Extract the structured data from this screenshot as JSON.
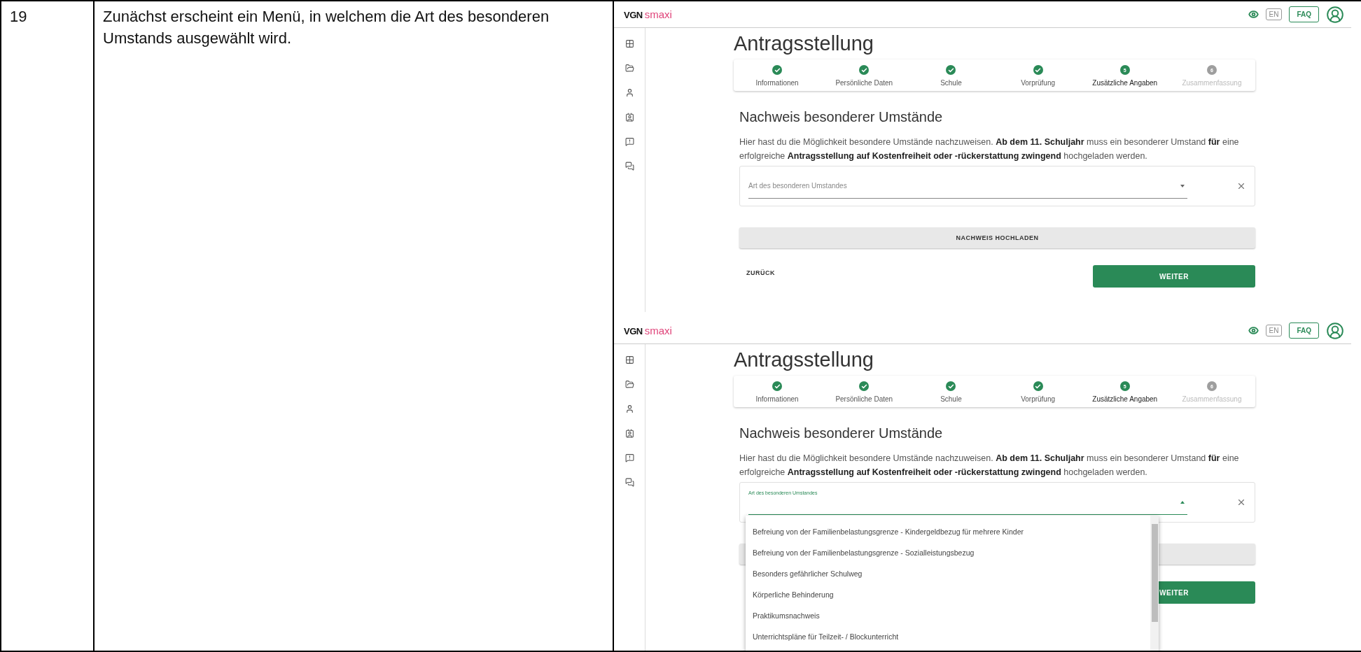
{
  "table": {
    "number": "19",
    "description": "Zunächst erscheint ein Menü, in welchem die Art des besonderen Umstands ausgewählt wird.",
    "screenshots": [
      {
        "logo_brand": "VGN",
        "logo_product": "smaxi",
        "language": "EN",
        "faq": "FAQ",
        "title": "Antragsstellung",
        "steps": [
          {
            "label": "Informationen",
            "completed": true,
            "selected": false
          },
          {
            "label": "Persönliche Daten",
            "completed": true,
            "selected": false
          },
          {
            "label": "Schule",
            "completed": true,
            "selected": false
          },
          {
            "label": "Vorprüfung",
            "completed": true,
            "selected": false
          },
          {
            "label": "Zusätzliche Angaben",
            "completed": false,
            "selected": true,
            "number": "5"
          },
          {
            "label": "Zusammenfassung",
            "completed": false,
            "selected": false,
            "number": "6"
          }
        ],
        "section_title": "Nachweis besonderer Umstände",
        "paragraph": "Hier hast du die Möglichkeit besondere Umstände nachzuweisen. **Ab dem 11. Schuljahr** muss ein besonderer Umstand **für** eine erfolgreiche **Antragsstellung auf Kostenfreiheit oder -rückerstattung zwingend** hochgeladen werden.",
        "field": {
          "label": "Art des besonderen Umstandes",
          "expanded": false
        },
        "upload_button": "NACHWEIS HOCHLADEN",
        "back_button": "ZURÜCK",
        "next_button": "WEITER"
      },
      {
        "logo_brand": "VGN",
        "logo_product": "smaxi",
        "language": "EN",
        "faq": "FAQ",
        "title": "Antragsstellung",
        "steps": [
          {
            "label": "Informationen",
            "completed": true,
            "selected": false
          },
          {
            "label": "Persönliche Daten",
            "completed": true,
            "selected": false
          },
          {
            "label": "Schule",
            "completed": true,
            "selected": false
          },
          {
            "label": "Vorprüfung",
            "completed": true,
            "selected": false
          },
          {
            "label": "Zusätzliche Angaben",
            "completed": false,
            "selected": true,
            "number": "5"
          },
          {
            "label": "Zusammenfassung",
            "completed": false,
            "selected": false,
            "number": "6"
          }
        ],
        "section_title": "Nachweis besonderer Umstände",
        "paragraph": "Hier hast du die Möglichkeit besondere Umstände nachzuweisen. **Ab dem 11. Schuljahr** muss ein besonderer Umstand **für** eine erfolgreiche **Antragsstellung auf Kostenfreiheit oder -rückerstattung zwingend** hochgeladen werden.",
        "field": {
          "label": "Art des besonderen Umstandes",
          "expanded": true
        },
        "options": [
          "Befreiung von der Familienbelastungsgrenze - Kindergeldbezug für mehrere Kinder",
          "Befreiung von der Familienbelastungsgrenze - Sozialleistungsbezug",
          "Besonders gefährlicher Schulweg",
          "Körperliche Behinderung",
          "Praktikumsnachweis",
          "Unterrichtspläne für Teilzeit- / Blockunterricht"
        ],
        "next_button": "WEITER"
      }
    ]
  }
}
